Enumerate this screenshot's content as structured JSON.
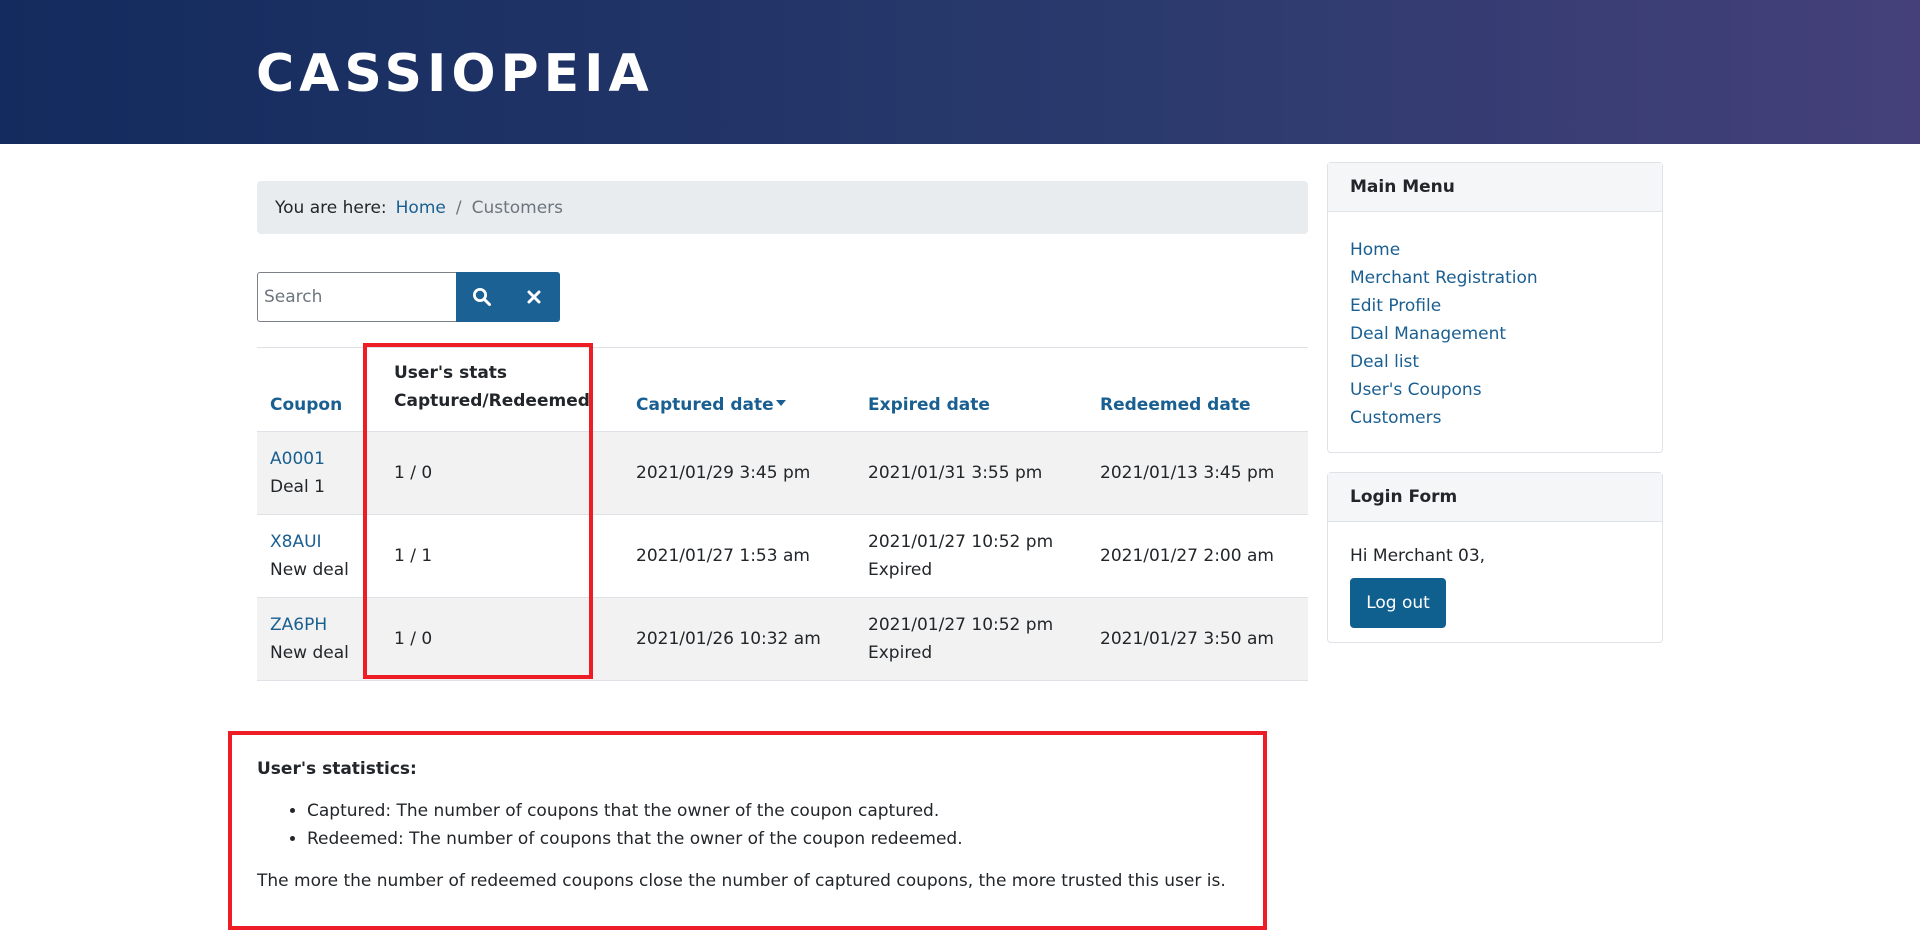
{
  "site": {
    "brand": "CASSIOPEIA"
  },
  "breadcrumb": {
    "prefix": "You are here:",
    "home": "Home",
    "separator": "/",
    "current": "Customers"
  },
  "search": {
    "placeholder": "Search",
    "value": "",
    "search_icon": "search-icon",
    "clear_icon": "close-icon"
  },
  "table": {
    "headers": {
      "coupon": "Coupon",
      "stats_line1": "User's stats",
      "stats_line2": "Captured/Redeemed",
      "captured": "Captured date",
      "expired": "Expired date",
      "redeemed": "Redeemed date"
    },
    "rows": [
      {
        "code": "A0001",
        "deal": "Deal 1",
        "stats": "1 / 0",
        "captured": "2021/01/29 3:45 pm",
        "expired": "2021/01/31 3:55 pm",
        "expired_status": "",
        "redeemed": "2021/01/13 3:45 pm"
      },
      {
        "code": "X8AUI",
        "deal": "New deal",
        "stats": "1 / 1",
        "captured": "2021/01/27 1:53 am",
        "expired": "2021/01/27 10:52 pm",
        "expired_status": "Expired",
        "redeemed": "2021/01/27 2:00 am"
      },
      {
        "code": "ZA6PH",
        "deal": "New deal",
        "stats": "1 / 0",
        "captured": "2021/01/26 10:32 am",
        "expired": "2021/01/27 10:52 pm",
        "expired_status": "Expired",
        "redeemed": "2021/01/27 3:50 am"
      }
    ]
  },
  "stats_info": {
    "title": "User's statistics:",
    "items": [
      "Captured: The number of coupons that the owner of the coupon captured.",
      "Redeemed: The number of coupons that the owner of the coupon redeemed."
    ],
    "note": "The more the number of redeemed coupons close the number of captured coupons, the more trusted this user is."
  },
  "sidebar": {
    "main_menu": {
      "title": "Main Menu",
      "items": [
        "Home",
        "Merchant Registration",
        "Edit Profile",
        "Deal Management",
        "Deal list",
        "User's Coupons",
        "Customers"
      ]
    },
    "login": {
      "title": "Login Form",
      "greeting": "Hi Merchant 03,",
      "logout_label": "Log out"
    }
  },
  "colors": {
    "header_start": "#132b5e",
    "header_end": "#45407a",
    "link": "#1a5f91",
    "button": "#1b6194",
    "highlight": "#ee1c24"
  }
}
